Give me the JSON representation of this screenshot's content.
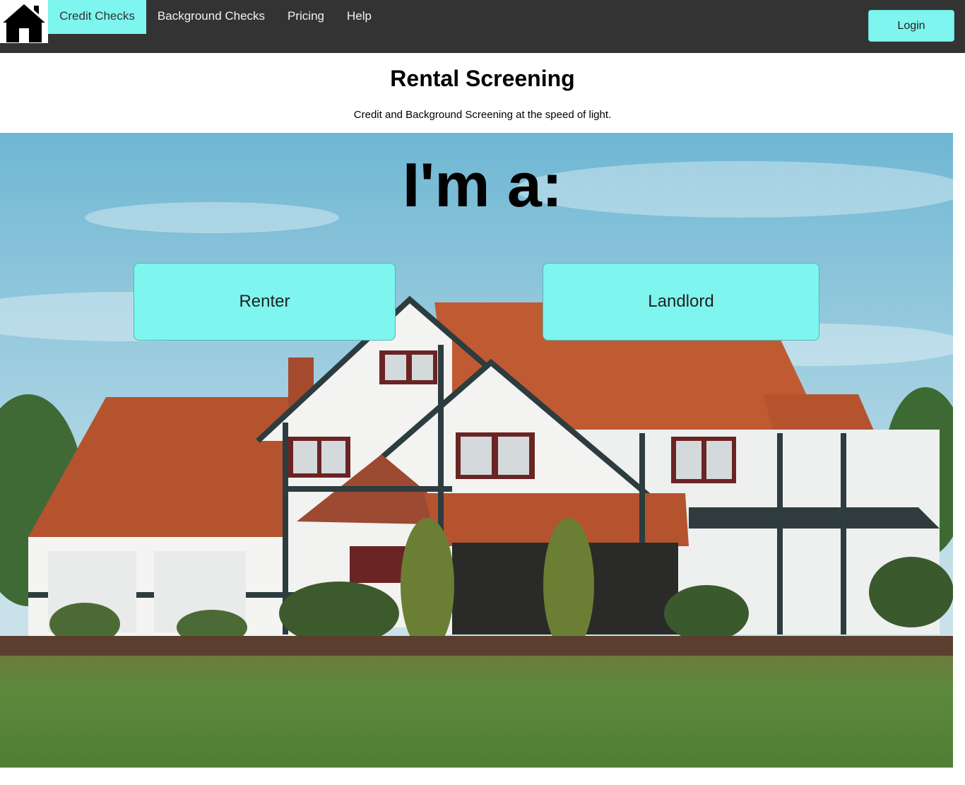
{
  "nav": {
    "home_icon": "house-icon",
    "items": [
      {
        "label": "Credit Checks",
        "active": true
      },
      {
        "label": "Background Checks",
        "active": false
      },
      {
        "label": "Pricing",
        "active": false
      },
      {
        "label": "Help",
        "active": false
      }
    ],
    "login_label": "Login"
  },
  "header": {
    "title": "Rental Screening",
    "subtitle": "Credit and Background Screening at the speed of light."
  },
  "hero": {
    "heading": "I'm a:",
    "renter_label": "Renter",
    "landlord_label": "Landlord",
    "background": "photo of a tudor-style house with red tile roof on a lawn under blue sky"
  },
  "colors": {
    "accent": "#7ef5ee",
    "nav_bg": "#333333",
    "text": "#000000"
  }
}
